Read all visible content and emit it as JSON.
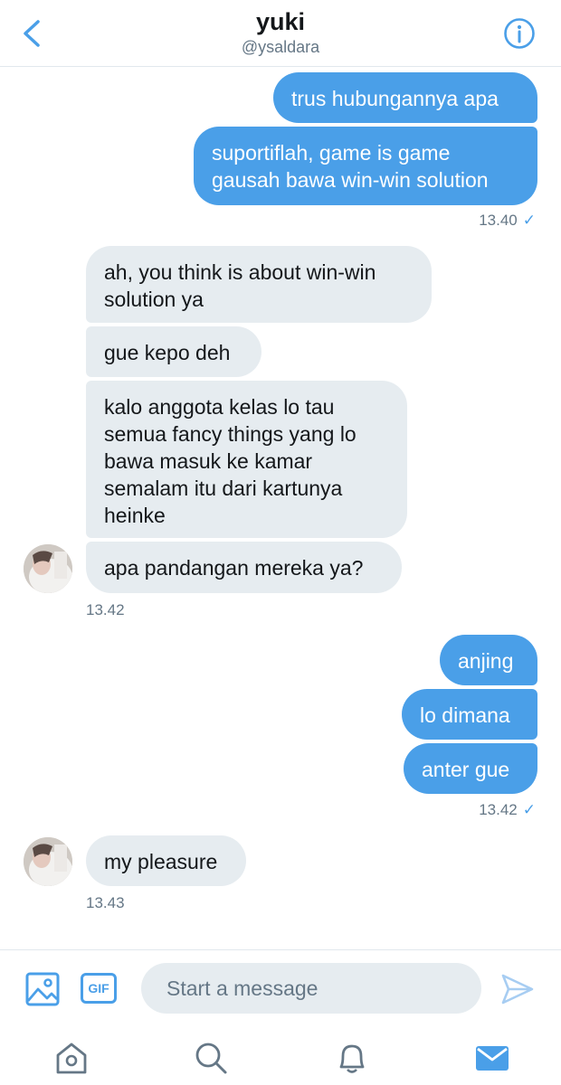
{
  "header": {
    "name": "yuki",
    "handle": "@ysaldara"
  },
  "messages": {
    "m1": "trus hubungannya apa",
    "m2": "suportiflah, game is game\ngausah bawa win-win solution",
    "t1": "13.40",
    "m3": "ah, you think is about win-win\nsolution ya",
    "m4": "gue kepo deh",
    "m5": "kalo anggota kelas lo tau\nsemua fancy things yang lo\nbawa masuk ke kamar\nsemalam itu dari kartunya\nheinke",
    "m6": "apa pandangan mereka ya?",
    "t2": "13.42",
    "m7": "anjing",
    "m8": "lo dimana",
    "m9": "anter gue",
    "t3": "13.42",
    "m10": "my pleasure",
    "t4": "13.43",
    "check": "✓"
  },
  "composer": {
    "placeholder": "Start a message",
    "gif_label": "GIF"
  },
  "colors": {
    "accent": "#4a9fe8",
    "incoming_bubble": "#e6ecf0",
    "muted_text": "#657786"
  },
  "icons": {
    "back": "chevron-left-icon",
    "info": "info-icon",
    "image": "image-icon",
    "gif": "gif-icon",
    "send": "send-icon",
    "home": "home-icon",
    "search": "search-icon",
    "notifications": "bell-icon",
    "messages": "mail-icon"
  }
}
